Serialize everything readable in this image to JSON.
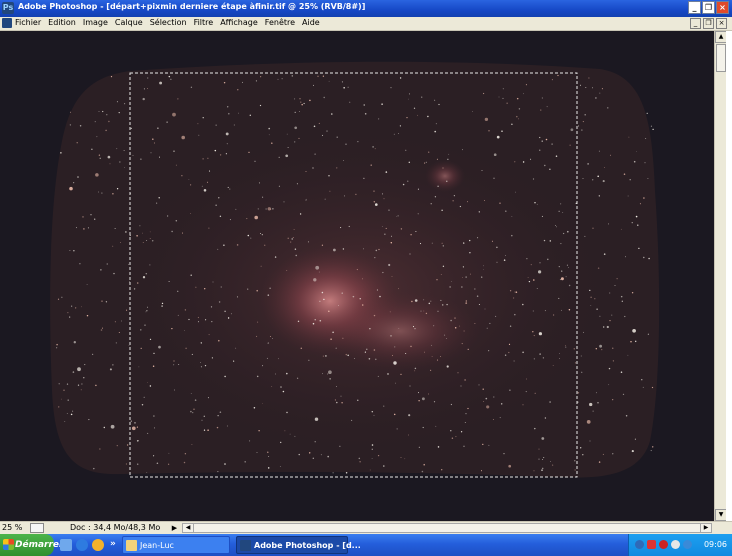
{
  "window": {
    "title": "Adobe Photoshop - [départ+pixmin derniere étape àfinir.tif @ 25% (RVB/8#)]",
    "app_icon": "photoshop-icon",
    "controls": [
      "minimize-icon",
      "restore-icon",
      "close-icon"
    ],
    "control_glyphs": {
      "minimize": "_",
      "restore": "❐",
      "close": "×"
    }
  },
  "menubar": {
    "items": [
      "Fichier",
      "Edition",
      "Image",
      "Calque",
      "Sélection",
      "Filtre",
      "Affichage",
      "Fenêtre",
      "Aide"
    ]
  },
  "document": {
    "content": "star-field-nebula-image",
    "colors": {
      "background": "#1b1821",
      "nebula": "#c26a6c",
      "stars": "#f3eee6"
    }
  },
  "statusbar": {
    "zoom": "25 %",
    "doc_info": "Doc : 34,4 Mo/48,3 Mo",
    "arrow_glyph": "▶"
  },
  "taskbar": {
    "start_label": "Démarrer",
    "quicklaunch": [
      "outlook-express-icon",
      "internet-explorer-icon",
      "media-player-icon"
    ],
    "overflow_glyph": "»",
    "tasks": [
      {
        "label": "Jean-Luc",
        "icon": "folder-icon"
      },
      {
        "label": "Adobe Photoshop - [d...",
        "icon": "photoshop-icon"
      }
    ],
    "tray_icons": [
      "network-icon",
      "antivirus-icon",
      "security-icon",
      "volume-icon",
      "update-icon"
    ],
    "clock": "09:06"
  },
  "scrollbar_glyphs": {
    "up": "▲",
    "down": "▼",
    "left": "◀",
    "right": "▶"
  }
}
